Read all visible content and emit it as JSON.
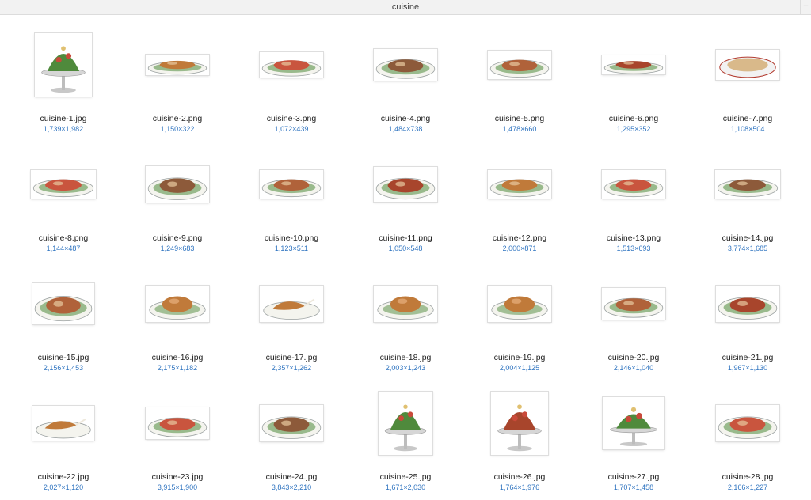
{
  "window": {
    "title": "cuisine",
    "collapse_glyph": "–"
  },
  "files": [
    {
      "name": "cuisine-1.jpg",
      "dimensions": "1,739×1,982",
      "icon": "dish-on-pedestal-icon"
    },
    {
      "name": "cuisine-2.png",
      "dimensions": "1,150×322",
      "icon": "platter-icon"
    },
    {
      "name": "cuisine-3.png",
      "dimensions": "1,072×439",
      "icon": "platter-icon"
    },
    {
      "name": "cuisine-4.png",
      "dimensions": "1,484×738",
      "icon": "platter-icon"
    },
    {
      "name": "cuisine-5.png",
      "dimensions": "1,478×660",
      "icon": "platter-icon"
    },
    {
      "name": "cuisine-6.png",
      "dimensions": "1,295×352",
      "icon": "platter-icon"
    },
    {
      "name": "cuisine-7.png",
      "dimensions": "1,108×504",
      "icon": "soup-bowl-icon"
    },
    {
      "name": "cuisine-8.png",
      "dimensions": "1,144×487",
      "icon": "platter-icon"
    },
    {
      "name": "cuisine-9.png",
      "dimensions": "1,249×683",
      "icon": "platter-icon"
    },
    {
      "name": "cuisine-10.png",
      "dimensions": "1,123×511",
      "icon": "platter-icon"
    },
    {
      "name": "cuisine-11.png",
      "dimensions": "1,050×548",
      "icon": "platter-icon"
    },
    {
      "name": "cuisine-12.png",
      "dimensions": "2,000×871",
      "icon": "platter-icon"
    },
    {
      "name": "cuisine-13.png",
      "dimensions": "1,513×693",
      "icon": "platter-icon"
    },
    {
      "name": "cuisine-14.jpg",
      "dimensions": "3,774×1,685",
      "icon": "platter-icon"
    },
    {
      "name": "cuisine-15.jpg",
      "dimensions": "2,156×1,453",
      "icon": "platter-icon"
    },
    {
      "name": "cuisine-16.jpg",
      "dimensions": "2,175×1,182",
      "icon": "roast-fowl-icon"
    },
    {
      "name": "cuisine-17.jpg",
      "dimensions": "2,357×1,262",
      "icon": "roast-leg-icon"
    },
    {
      "name": "cuisine-18.jpg",
      "dimensions": "2,003×1,243",
      "icon": "roast-fowl-icon"
    },
    {
      "name": "cuisine-19.jpg",
      "dimensions": "2,004×1,125",
      "icon": "roast-fowl-icon"
    },
    {
      "name": "cuisine-20.jpg",
      "dimensions": "2,146×1,040",
      "icon": "platter-icon"
    },
    {
      "name": "cuisine-21.jpg",
      "dimensions": "1,967×1,130",
      "icon": "platter-icon"
    },
    {
      "name": "cuisine-22.jpg",
      "dimensions": "2,027×1,120",
      "icon": "roast-leg-icon"
    },
    {
      "name": "cuisine-23.jpg",
      "dimensions": "3,915×1,900",
      "icon": "platter-icon"
    },
    {
      "name": "cuisine-24.jpg",
      "dimensions": "3,843×2,210",
      "icon": "platter-icon"
    },
    {
      "name": "cuisine-25.jpg",
      "dimensions": "1,671×2,030",
      "icon": "dish-on-pedestal-icon"
    },
    {
      "name": "cuisine-26.jpg",
      "dimensions": "1,764×1,976",
      "icon": "dish-on-pedestal-icon"
    },
    {
      "name": "cuisine-27.jpg",
      "dimensions": "1,707×1,458",
      "icon": "dish-on-pedestal-icon"
    },
    {
      "name": "cuisine-28.jpg",
      "dimensions": "2,166×1,227",
      "icon": "platter-icon"
    }
  ],
  "colors": {
    "dimension_text": "#2f74c0",
    "plate": "#f4f4ee",
    "meat": "#a8452c",
    "greens": "#4f8a3c",
    "crust": "#c07a3a",
    "sauce": "#d9b98a"
  }
}
